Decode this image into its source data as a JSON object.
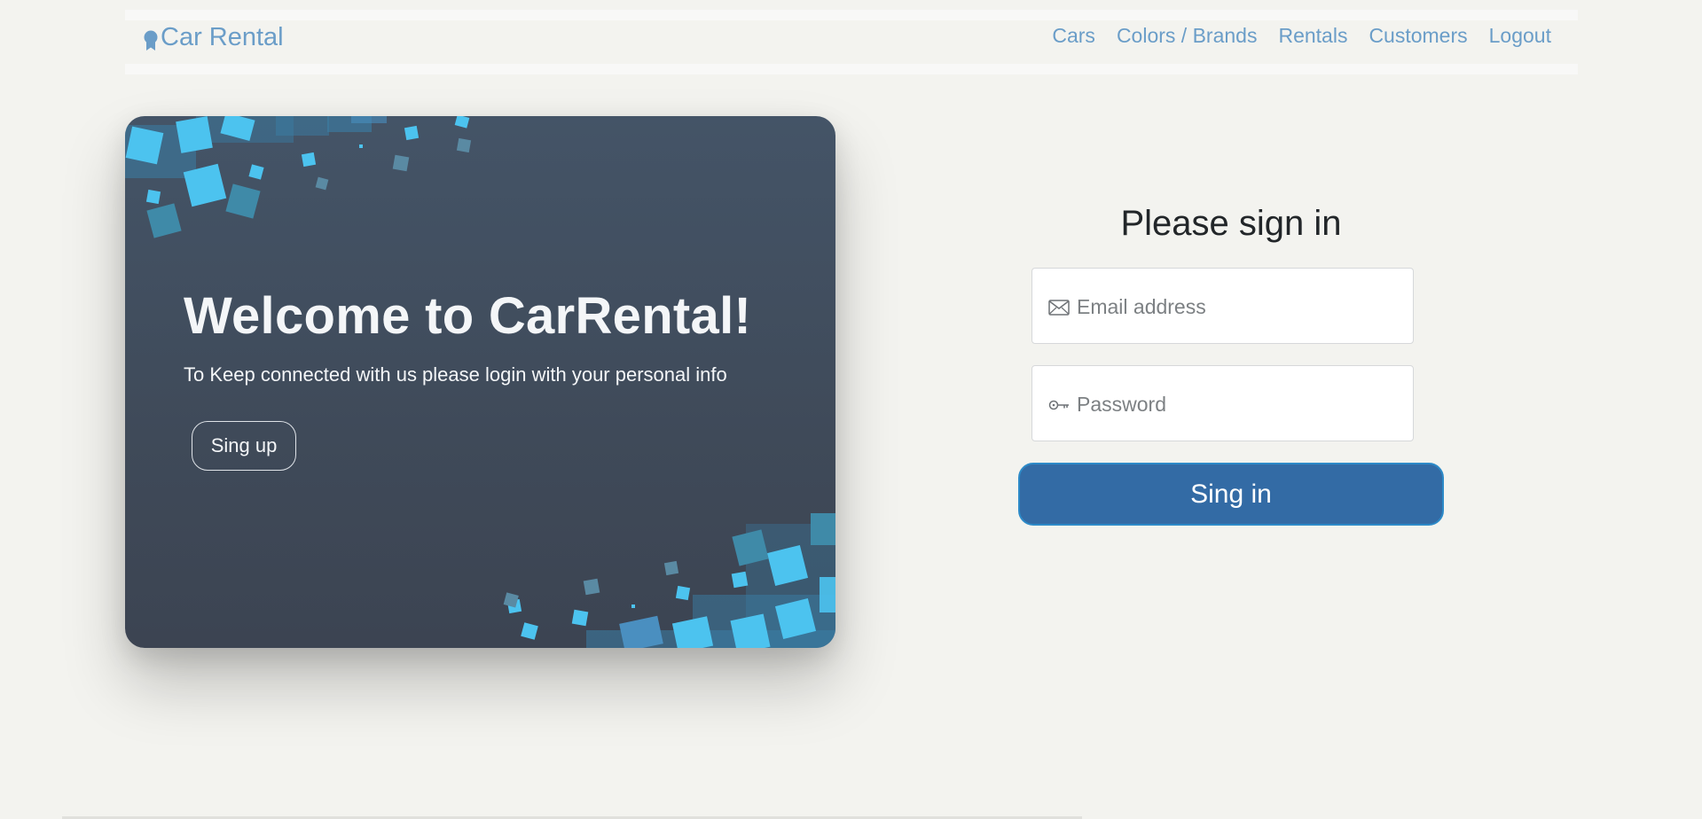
{
  "navbar": {
    "brand": "Car Rental",
    "brand_icon": "award-icon",
    "links": [
      "Cars",
      "Colors / Brands",
      "Rentals",
      "Customers",
      "Logout"
    ]
  },
  "welcome": {
    "title": "Welcome to CarRental!",
    "subtitle": "To Keep connected with us please login with your personal info",
    "signup_label": "Sing up"
  },
  "signin": {
    "title": "Please sign in",
    "email": {
      "placeholder": "Email address",
      "value": "",
      "icon": "envelope-icon"
    },
    "password": {
      "placeholder": "Password",
      "value": "",
      "icon": "key-icon"
    },
    "button_label": "Sing in"
  },
  "colors": {
    "accent": "#336ba5",
    "link": "#6a9dc8",
    "card_bg": "#445467",
    "page_bg": "#f3f3ef"
  }
}
